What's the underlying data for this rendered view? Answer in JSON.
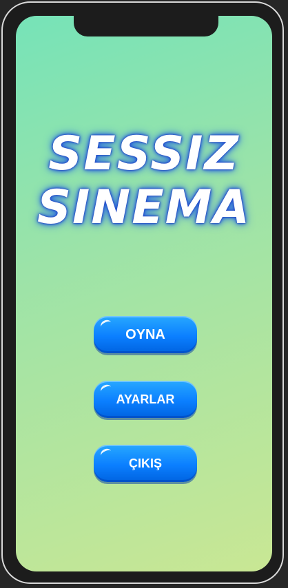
{
  "app": {
    "title_lines": [
      "SESSIZ",
      "SINEMA"
    ]
  },
  "menu": {
    "play_label": "OYNA",
    "settings_label": "AYARLAR",
    "exit_label": "ÇIKIŞ"
  },
  "colors": {
    "button_blue": "#0b7fff",
    "background_start": "#76e3b8",
    "background_end": "#c9e794",
    "title_glow": "#2a6de4"
  }
}
